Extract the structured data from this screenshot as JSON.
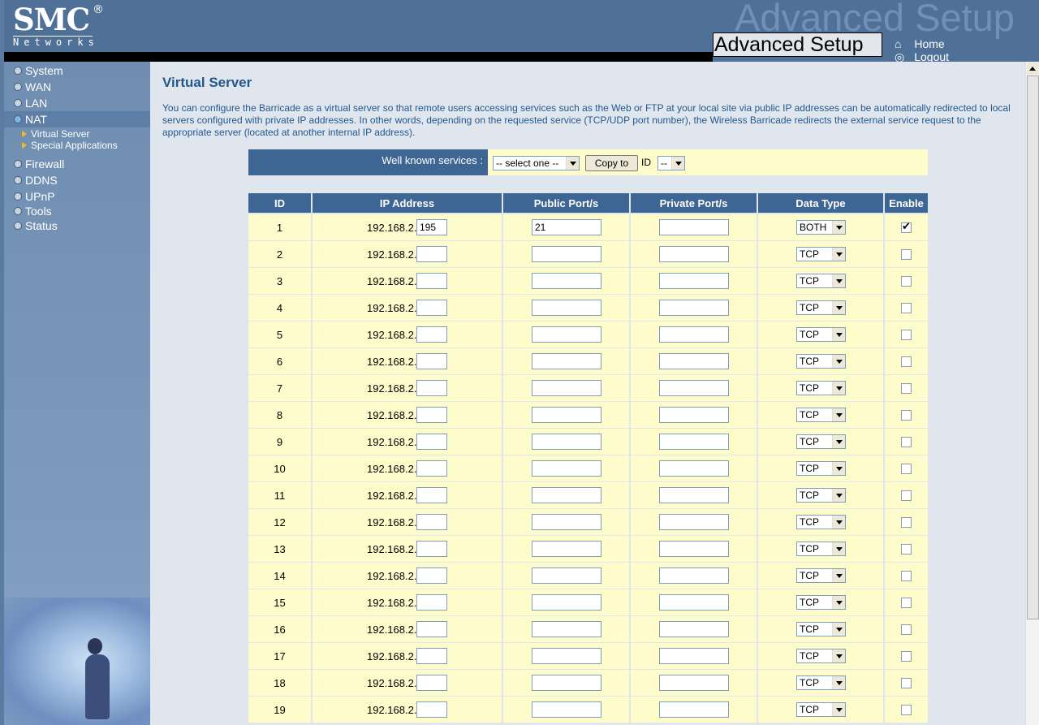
{
  "header": {
    "brand": "SMC",
    "brand_mark": "®",
    "brand_sub": "Networks",
    "watermark": "Advanced Setup",
    "title": "Advanced Setup",
    "home_label": "Home",
    "logout_label": "Logout"
  },
  "sidebar": {
    "items": [
      {
        "label": "System"
      },
      {
        "label": "WAN"
      },
      {
        "label": "LAN"
      },
      {
        "label": "NAT"
      },
      {
        "label": "Firewall"
      },
      {
        "label": "DDNS"
      },
      {
        "label": "UPnP"
      },
      {
        "label": "Tools"
      },
      {
        "label": "Status"
      }
    ],
    "nat_sub": [
      {
        "label": "Virtual Server"
      },
      {
        "label": "Special Applications"
      }
    ]
  },
  "main": {
    "title": "Virtual Server",
    "description": "You can configure the Barricade as a virtual server so that remote users accessing services such as the Web or FTP at your local site via public IP addresses can be automatically redirected to local servers configured with private IP addresses. In other words, depending on the requested service (TCP/UDP port number), the Wireless Barricade redirects the external service request to the appropriate server (located at another internal IP address).",
    "wks_label": "Well known services :",
    "wks_select": "-- select one --",
    "copy_button": "Copy to",
    "id_label": "ID",
    "id_select": "--"
  },
  "table": {
    "headers": [
      "ID",
      "IP Address",
      "Public Port/s",
      "Private Port/s",
      "Data Type",
      "Enable"
    ],
    "ip_prefix": "192.168.2.",
    "rows": [
      {
        "id": "1",
        "ip": "195",
        "public": "21",
        "private": "",
        "type": "BOTH",
        "enabled": true
      },
      {
        "id": "2",
        "ip": "",
        "public": "",
        "private": "",
        "type": "TCP",
        "enabled": false
      },
      {
        "id": "3",
        "ip": "",
        "public": "",
        "private": "",
        "type": "TCP",
        "enabled": false
      },
      {
        "id": "4",
        "ip": "",
        "public": "",
        "private": "",
        "type": "TCP",
        "enabled": false
      },
      {
        "id": "5",
        "ip": "",
        "public": "",
        "private": "",
        "type": "TCP",
        "enabled": false
      },
      {
        "id": "6",
        "ip": "",
        "public": "",
        "private": "",
        "type": "TCP",
        "enabled": false
      },
      {
        "id": "7",
        "ip": "",
        "public": "",
        "private": "",
        "type": "TCP",
        "enabled": false
      },
      {
        "id": "8",
        "ip": "",
        "public": "",
        "private": "",
        "type": "TCP",
        "enabled": false
      },
      {
        "id": "9",
        "ip": "",
        "public": "",
        "private": "",
        "type": "TCP",
        "enabled": false
      },
      {
        "id": "10",
        "ip": "",
        "public": "",
        "private": "",
        "type": "TCP",
        "enabled": false
      },
      {
        "id": "11",
        "ip": "",
        "public": "",
        "private": "",
        "type": "TCP",
        "enabled": false
      },
      {
        "id": "12",
        "ip": "",
        "public": "",
        "private": "",
        "type": "TCP",
        "enabled": false
      },
      {
        "id": "13",
        "ip": "",
        "public": "",
        "private": "",
        "type": "TCP",
        "enabled": false
      },
      {
        "id": "14",
        "ip": "",
        "public": "",
        "private": "",
        "type": "TCP",
        "enabled": false
      },
      {
        "id": "15",
        "ip": "",
        "public": "",
        "private": "",
        "type": "TCP",
        "enabled": false
      },
      {
        "id": "16",
        "ip": "",
        "public": "",
        "private": "",
        "type": "TCP",
        "enabled": false
      },
      {
        "id": "17",
        "ip": "",
        "public": "",
        "private": "",
        "type": "TCP",
        "enabled": false
      },
      {
        "id": "18",
        "ip": "",
        "public": "",
        "private": "",
        "type": "TCP",
        "enabled": false
      },
      {
        "id": "19",
        "ip": "",
        "public": "",
        "private": "",
        "type": "TCP",
        "enabled": false
      }
    ]
  },
  "colors": {
    "header_bg": "#4f7198",
    "table_header": "#3e6695",
    "cell_bg": "#fffccc",
    "title_text": "#23588d"
  },
  "icons": [
    "home-icon",
    "logout-icon",
    "nav-bullet-icon",
    "sub-arrow-icon",
    "dropdown-arrow-icon",
    "checkbox-icon"
  ]
}
